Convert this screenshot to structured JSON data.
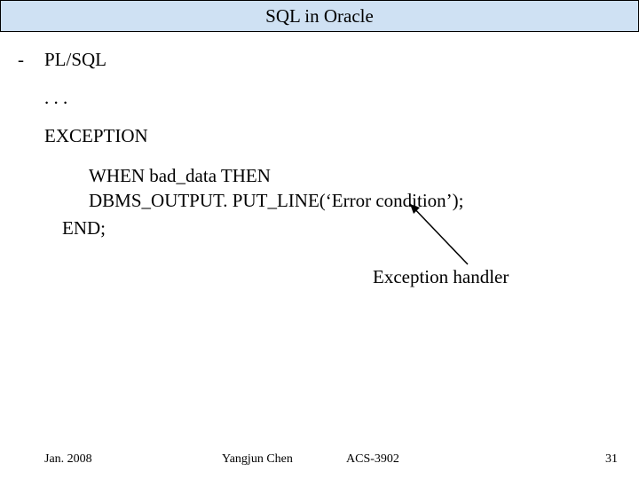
{
  "title": "SQL in Oracle",
  "bullet_dash": "-",
  "heading": "PL/SQL",
  "dots": ". . .",
  "exc_keyword": "EXCEPTION",
  "code_line1": "WHEN bad_data THEN",
  "code_line2": "DBMS_OUTPUT. PUT_LINE(‘Error condition’);",
  "code_end": "END;",
  "annotation": "Exception handler",
  "footer": {
    "date": "Jan. 2008",
    "author": "Yangjun Chen",
    "course": "ACS-3902",
    "page": "31"
  }
}
